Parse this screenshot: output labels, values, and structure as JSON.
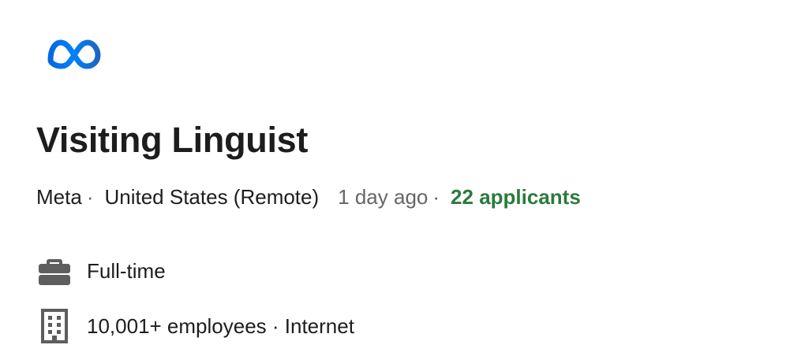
{
  "brand": {
    "logo_icon": "meta-infinity-logo-icon",
    "logo_colors": [
      "#0668E1",
      "#0081FB",
      "#1D65C1"
    ]
  },
  "job": {
    "title": "Visiting Linguist",
    "company": "Meta",
    "separator": "·",
    "location": "United States (Remote)",
    "posted": "1 day ago",
    "applicants": "22 applicants"
  },
  "details": [
    {
      "icon": "briefcase-icon",
      "text": "Full-time"
    },
    {
      "icon": "building-icon",
      "text": "10,001+ employees · Internet"
    }
  ],
  "colors": {
    "title": "#1d1d1d",
    "secondary_text": "#666666",
    "applicants": "#2b7a3d",
    "icon": "#5e5e5e"
  }
}
